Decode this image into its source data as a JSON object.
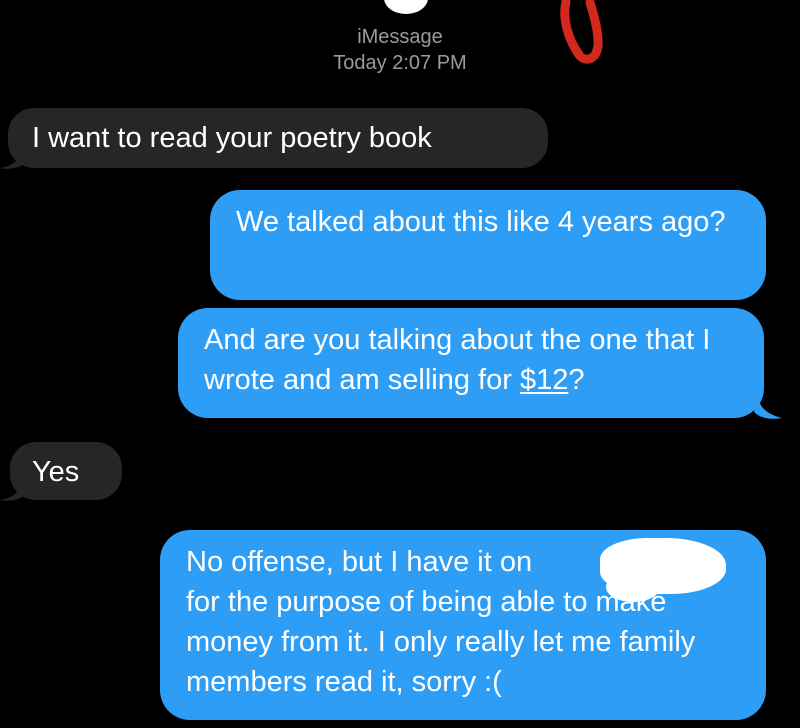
{
  "header": {
    "service": "iMessage",
    "timestamp": "Today 2:07 PM"
  },
  "messages": [
    {
      "side": "received",
      "text": "I want to read your poetry book"
    },
    {
      "side": "sent",
      "text": "We talked about this like 4 years ago?"
    },
    {
      "side": "sent",
      "text_before": "And are you talking about the one that I wrote and am selling for ",
      "link": "$12",
      "text_after": "?"
    },
    {
      "side": "received",
      "text": "Yes"
    },
    {
      "side": "sent",
      "text_line1": "No offense, but I have it on",
      "text_rest": "for the purpose of being able to make money from it. I only really let me family members read it, sorry :("
    }
  ],
  "colors": {
    "background": "#000000",
    "received_bubble": "#262628",
    "sent_bubble": "#2d9df5",
    "annotation_red": "#d2281e"
  }
}
